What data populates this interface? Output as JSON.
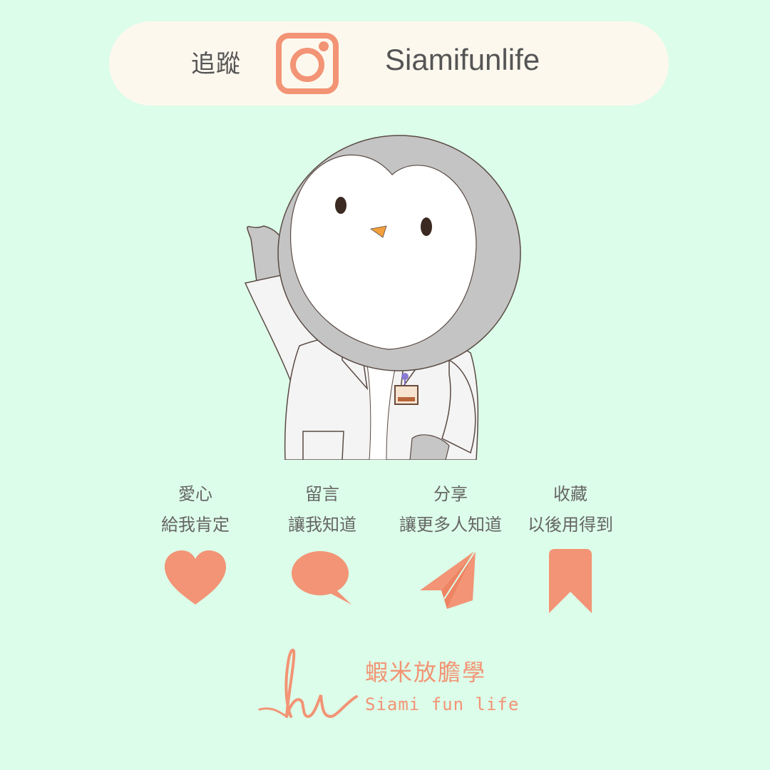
{
  "header": {
    "follow_label": "追蹤",
    "icon": "instagram-icon",
    "handle": "Siamifunlife"
  },
  "actions": [
    {
      "title": "愛心",
      "subtitle": "給我肯定",
      "icon": "heart-icon"
    },
    {
      "title": "留言",
      "subtitle": "讓我知道",
      "icon": "speech-bubble-icon"
    },
    {
      "title": "分享",
      "subtitle": "讓更多人知道",
      "icon": "paper-plane-icon"
    },
    {
      "title": "收藏",
      "subtitle": "以後用得到",
      "icon": "bookmark-icon"
    }
  ],
  "brand": {
    "name_cn": "蝦米放膽學",
    "name_en": "Siami fun life"
  },
  "colors": {
    "background": "#dcfde9",
    "pill": "#fdf8ee",
    "accent": "#f29475",
    "text": "#555555"
  }
}
